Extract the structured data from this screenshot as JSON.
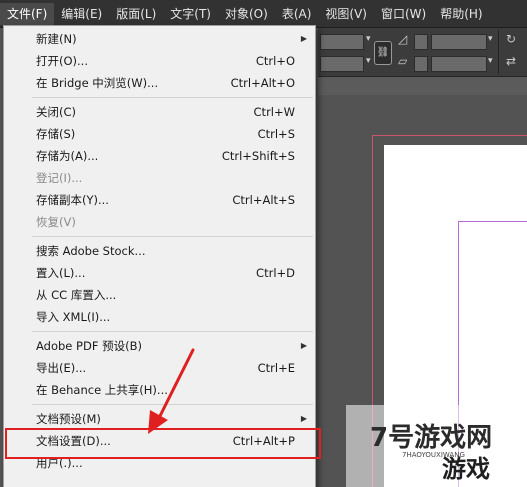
{
  "menubar": {
    "items": [
      {
        "label": "文件(F)"
      },
      {
        "label": "编辑(E)"
      },
      {
        "label": "版面(L)"
      },
      {
        "label": "文字(T)"
      },
      {
        "label": "对象(O)"
      },
      {
        "label": "表(A)"
      },
      {
        "label": "视图(V)"
      },
      {
        "label": "窗口(W)"
      },
      {
        "label": "帮助(H)"
      }
    ]
  },
  "file_menu": {
    "groups": [
      [
        {
          "label": "新建(N)",
          "submenu": true,
          "icon": "triangle-right"
        },
        {
          "label": "打开(O)...",
          "shortcut": "Ctrl+O"
        },
        {
          "label": "在 Bridge 中浏览(W)...",
          "shortcut": "Ctrl+Alt+O"
        }
      ],
      [
        {
          "label": "关闭(C)",
          "shortcut": "Ctrl+W"
        },
        {
          "label": "存储(S)",
          "shortcut": "Ctrl+S"
        },
        {
          "label": "存储为(A)...",
          "shortcut": "Ctrl+Shift+S"
        },
        {
          "label": "登记(I)...",
          "disabled": true
        },
        {
          "label": "存储副本(Y)...",
          "shortcut": "Ctrl+Alt+S"
        },
        {
          "label": "恢复(V)",
          "disabled": true
        }
      ],
      [
        {
          "label": "搜索 Adobe Stock..."
        },
        {
          "label": "置入(L)...",
          "shortcut": "Ctrl+D"
        },
        {
          "label": "从 CC 库置入..."
        },
        {
          "label": "导入 XML(I)..."
        }
      ],
      [
        {
          "label": "Adobe PDF 预设(B)",
          "submenu": true,
          "icon": "triangle-right"
        },
        {
          "label": "导出(E)...",
          "shortcut": "Ctrl+E"
        },
        {
          "label": "在 Behance 上共享(H)..."
        }
      ],
      [
        {
          "label": "文档预设(M)",
          "submenu": true,
          "icon": "triangle-right"
        },
        {
          "label": "文档设置(D)...",
          "shortcut": "Ctrl+Alt+P",
          "highlighted": true
        },
        {
          "label": "用户(.)..."
        }
      ]
    ]
  },
  "watermark": {
    "brand": "7号游戏网",
    "sub": "7HAOYOUXIWANG",
    "big": "游戏"
  },
  "colors": {
    "menubar_bg": "#323232",
    "menu_bg": "#f0f0f0",
    "annotation": "#e02020",
    "bleed": "#c9556a",
    "margin": "#b56bd6"
  }
}
